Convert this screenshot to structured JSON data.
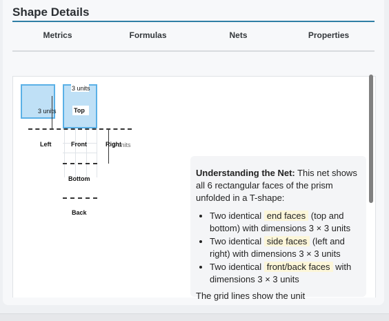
{
  "title": "Shape Details",
  "tabs": [
    "Metrics",
    "Formulas",
    "Nets",
    "Properties"
  ],
  "net": {
    "faces": {
      "left": "Left",
      "front": "Front",
      "right": "Right",
      "bottom": "Bottom",
      "back": "Back",
      "top": "Top"
    },
    "dimensions": {
      "top": "3 units",
      "left": "3 units",
      "right": "3 units"
    }
  },
  "info": {
    "heading": "Understanding the Net:",
    "intro": " This net shows all 6 rectangular faces of the prism unfolded in a T-shape:",
    "items": [
      {
        "prefix": "Two identical ",
        "highlight": "end faces",
        "suffix": " (top and bottom) with dimensions 3 × 3 units"
      },
      {
        "prefix": "Two identical ",
        "highlight": "side faces",
        "suffix": " (left and right) with dimensions 3 × 3 units"
      },
      {
        "prefix": "Two identical ",
        "highlight": "front/back faces",
        "suffix": " with dimensions 3 × 3 units"
      }
    ],
    "trailing": "The grid lines show the unit"
  },
  "colors": {
    "accent": "#2f7fa5",
    "face_fill": "#bfe0f6",
    "face_border": "#5ab0e6",
    "highlight": "#fcf6d9"
  }
}
